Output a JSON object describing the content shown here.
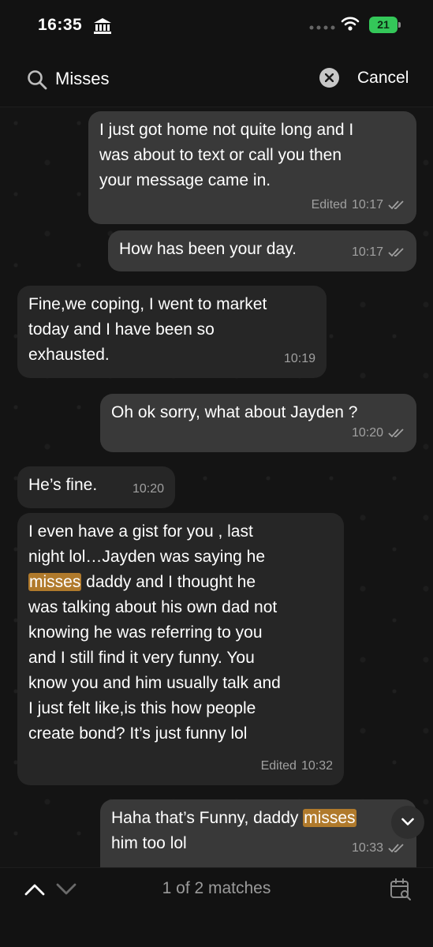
{
  "status_bar": {
    "time": "16:35",
    "battery": "21"
  },
  "search": {
    "query": "Misses",
    "cancel_label": "Cancel"
  },
  "messages": [
    {
      "line1": "I just got home not quite long and I",
      "line2": "was about to text or call you then",
      "line3": "your message came in.",
      "edited": "Edited",
      "time": "10:17"
    },
    {
      "text": "How has been your day.",
      "time": "10:17"
    },
    {
      "line1": "Fine,we coping, I went to market",
      "line2": "today and I have been so",
      "line3": "exhausted.",
      "time": "10:19"
    },
    {
      "text": "Oh ok sorry, what about Jayden ?",
      "time": "10:20"
    },
    {
      "text": "He’s fine.",
      "time": "10:20"
    },
    {
      "line1": "I even have a gist for you , last",
      "line2": "night lol…Jayden was saying he",
      "line3_hl": "misses",
      "line3_rest": " daddy and I thought he",
      "line4": "was talking about his own dad not",
      "line5": "knowing he was referring to you",
      "line6": "and I still find it very funny. You",
      "line7": "know you and him usually talk and",
      "line8": "I just felt like,is this how people",
      "line9": "create bond? It’s just funny lol",
      "edited": "Edited",
      "time": "10:32"
    },
    {
      "line1_pre": "Haha that’s Funny, daddy ",
      "line1_hl": "misses",
      "line2": "him too lol",
      "time": "10:33"
    }
  ],
  "footer": {
    "matches": "1 of 2 matches"
  },
  "colors": {
    "highlight": "#b07a2c",
    "battery": "#34c759",
    "incoming": "#262626",
    "outgoing": "#393939"
  },
  "icons": [
    "bank-icon",
    "signal-dots-icon",
    "wifi-icon",
    "search-icon",
    "clear-icon",
    "double-check-icon",
    "chevron-down-icon",
    "chevron-up-icon",
    "calendar-search-icon"
  ]
}
